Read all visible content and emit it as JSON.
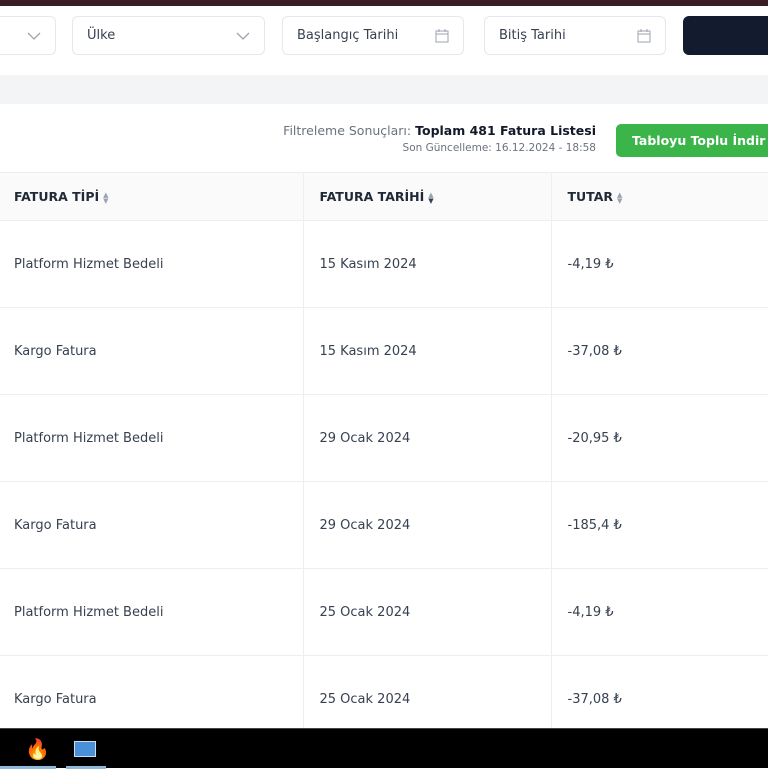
{
  "filters": {
    "first_select": "",
    "country": "Ülke",
    "start_date": "Başlangıç Tarihi",
    "end_date": "Bitiş Tarihi"
  },
  "summary": {
    "label": "Filtreleme Sonuçları:",
    "total": "Toplam 481 Fatura Listesi",
    "updated": "Son Güncelleme: 16.12.2024 - 18:58"
  },
  "download_button": "Tabloyu Toplu İndir",
  "table": {
    "headers": [
      "FATURA TİPİ",
      "FATURA TARİHİ",
      "TUTAR"
    ],
    "rows": [
      [
        "Platform Hizmet Bedeli",
        "15 Kasım 2024",
        "-4,19 ₺"
      ],
      [
        "Kargo Fatura",
        "15 Kasım 2024",
        "-37,08 ₺"
      ],
      [
        "Platform Hizmet Bedeli",
        "29 Ocak 2024",
        "-20,95 ₺"
      ],
      [
        "Kargo Fatura",
        "29 Ocak 2024",
        "-185,4 ₺"
      ],
      [
        "Platform Hizmet Bedeli",
        "25 Ocak 2024",
        "-4,19 ₺"
      ],
      [
        "Kargo Fatura",
        "25 Ocak 2024",
        "-37,08 ₺"
      ]
    ]
  },
  "colors": {
    "accent_green": "#3bb54a",
    "dark_button": "#131c2e",
    "top_bar": "#3b1e24"
  },
  "taskbar": {
    "icons": [
      "flame-app-icon",
      "window-app-icon"
    ]
  }
}
